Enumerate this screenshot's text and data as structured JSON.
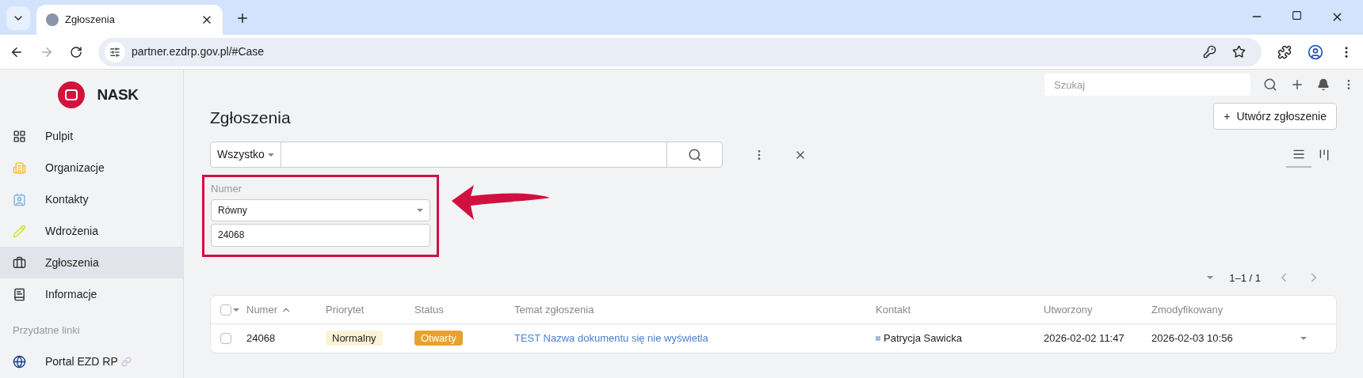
{
  "browser": {
    "tab_title": "Zgłoszenia",
    "url": "partner.ezdrp.gov.pl/#Case"
  },
  "sidebar": {
    "logo_text": "NASK",
    "items": [
      {
        "label": "Pulpit",
        "selected": false
      },
      {
        "label": "Organizacje",
        "selected": false
      },
      {
        "label": "Kontakty",
        "selected": false
      },
      {
        "label": "Wdrożenia",
        "selected": false
      },
      {
        "label": "Zgłoszenia",
        "selected": true
      },
      {
        "label": "Informacje",
        "selected": false
      }
    ],
    "section_title": "Przydatne linki",
    "links": [
      {
        "label": "Portal EZD RP"
      }
    ]
  },
  "topbar": {
    "search_placeholder": "Szukaj"
  },
  "page": {
    "title": "Zgłoszenia",
    "create_button": "Utwórz zgłoszenie",
    "create_icon": "+",
    "filter_scope": "Wszystko",
    "filter": {
      "label": "Numer",
      "operator": "Równy",
      "value": "24068"
    },
    "views": [
      {
        "kind": "list",
        "selected": true
      },
      {
        "kind": "board",
        "selected": false
      }
    ],
    "pagination": "1–1 / 1"
  },
  "table": {
    "select_all_checked": false,
    "columns": [
      {
        "label": "Numer",
        "sorted": true
      },
      {
        "label": "Priorytet",
        "sorted": false
      },
      {
        "label": "Status",
        "sorted": false
      },
      {
        "label": "Temat zgłoszenia",
        "sorted": false
      },
      {
        "label": "Kontakt",
        "sorted": false
      },
      {
        "label": "Utworzony",
        "sorted": false
      },
      {
        "label": "Zmodyfikowany",
        "sorted": false
      }
    ],
    "rows": [
      {
        "checked": false,
        "number": "24068",
        "priority": "Normalny",
        "status": "Otwarty",
        "subject": "TEST Nazwa dokumentu się nie wyświetla",
        "contact": "Patrycja Sawicka",
        "created": "2026-02-02 11:47",
        "modified": "2026-02-03 10:56"
      }
    ]
  }
}
